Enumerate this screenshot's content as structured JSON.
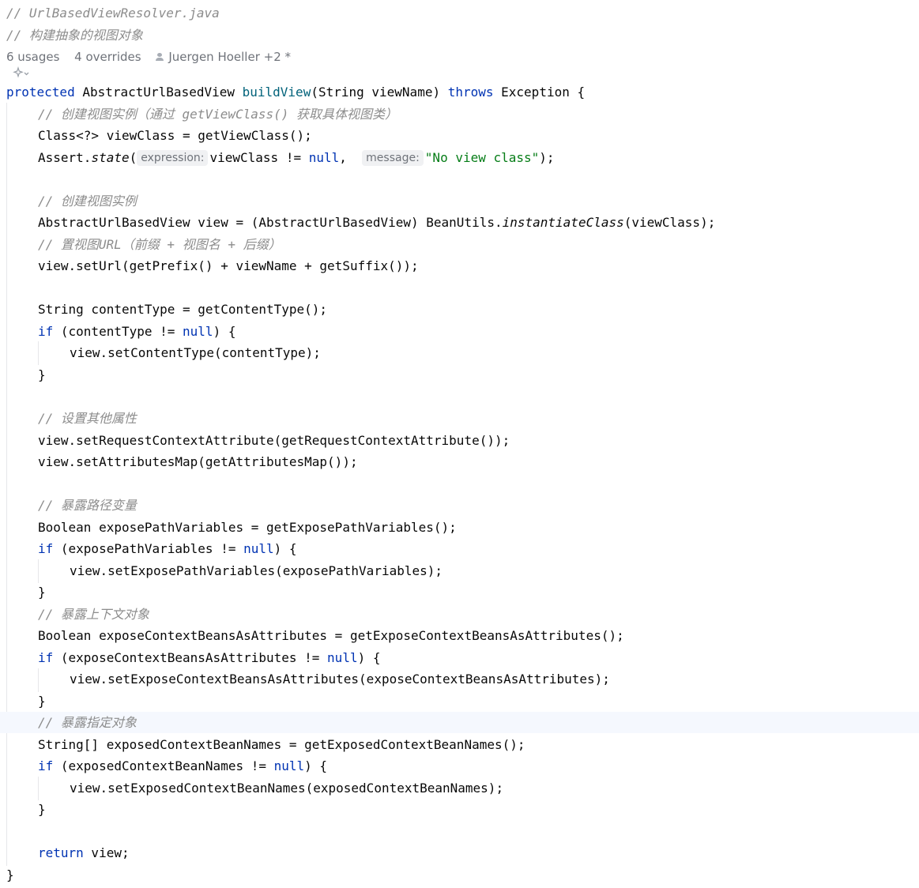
{
  "header_comments": [
    "// UrlBasedViewResolver.java",
    "// 构建抽象的视图对象"
  ],
  "meta": {
    "usages": "6 usages",
    "overrides": "4 overrides",
    "author": "Juergen Hoeller +2 *"
  },
  "icons": {
    "ai_assist": "ai-sparkle-icon",
    "author": "person-icon",
    "chevron": "chevron-down-icon"
  },
  "colors": {
    "keyword": "#0033b3",
    "method": "#00627a",
    "string": "#067d17",
    "comment": "#8c8c8c",
    "highlight_line": "#f5f8fe"
  },
  "code": {
    "l1_kw": "protected",
    "l1_type": " AbstractUrlBasedView ",
    "l1_fn": "buildView",
    "l1_args": "(String viewName) ",
    "l1_throws": "throws",
    "l1_tail": " Exception {",
    "c1": "// 创建视图实例（通过 getViewClass() 获取具体视图类）",
    "l3": "Class<?> viewClass = getViewClass();",
    "l4_a": "Assert.",
    "l4_b": "state",
    "l4_c": "(",
    "l4_hint1": "expression:",
    "l4_d": "viewClass != ",
    "l4_null": "null",
    "l4_e": ",  ",
    "l4_hint2": "message:",
    "l4_str": "\"No view class\"",
    "l4_f": ");",
    "c2": "// 创建视图实例",
    "l6_a": "AbstractUrlBasedView view = (AbstractUrlBasedView) BeanUtils.",
    "l6_b": "instantiateClass",
    "l6_c": "(viewClass);",
    "c3": "// 置视图URL（前缀 + 视图名 + 后缀）",
    "l8": "view.setUrl(getPrefix() + viewName + getSuffix());",
    "l10": "String contentType = getContentType();",
    "l11_kw": "if",
    "l11_a": " (contentType != ",
    "l11_null": "null",
    "l11_b": ") {",
    "l12": "view.setContentType(contentType);",
    "close": "}",
    "c4": "// 设置其他属性",
    "l15": "view.setRequestContextAttribute(getRequestContextAttribute());",
    "l16": "view.setAttributesMap(getAttributesMap());",
    "c5": "// 暴露路径变量",
    "l18": "Boolean exposePathVariables = getExposePathVariables();",
    "l19_kw": "if",
    "l19_a": " (exposePathVariables != ",
    "l19_null": "null",
    "l19_b": ") {",
    "l20": "view.setExposePathVariables(exposePathVariables);",
    "c6": "// 暴露上下文对象",
    "l23": "Boolean exposeContextBeansAsAttributes = getExposeContextBeansAsAttributes();",
    "l24_kw": "if",
    "l24_a": " (exposeContextBeansAsAttributes != ",
    "l24_null": "null",
    "l24_b": ") {",
    "l25": "view.setExposeContextBeansAsAttributes(exposeContextBeansAsAttributes);",
    "c7": "// 暴露指定对象",
    "l28": "String[] exposedContextBeanNames = getExposedContextBeanNames();",
    "l29_kw": "if",
    "l29_a": " (exposedContextBeanNames != ",
    "l29_null": "null",
    "l29_b": ") {",
    "l30": "view.setExposedContextBeanNames(exposedContextBeanNames);",
    "l33_kw": "return",
    "l33_a": " view;"
  }
}
